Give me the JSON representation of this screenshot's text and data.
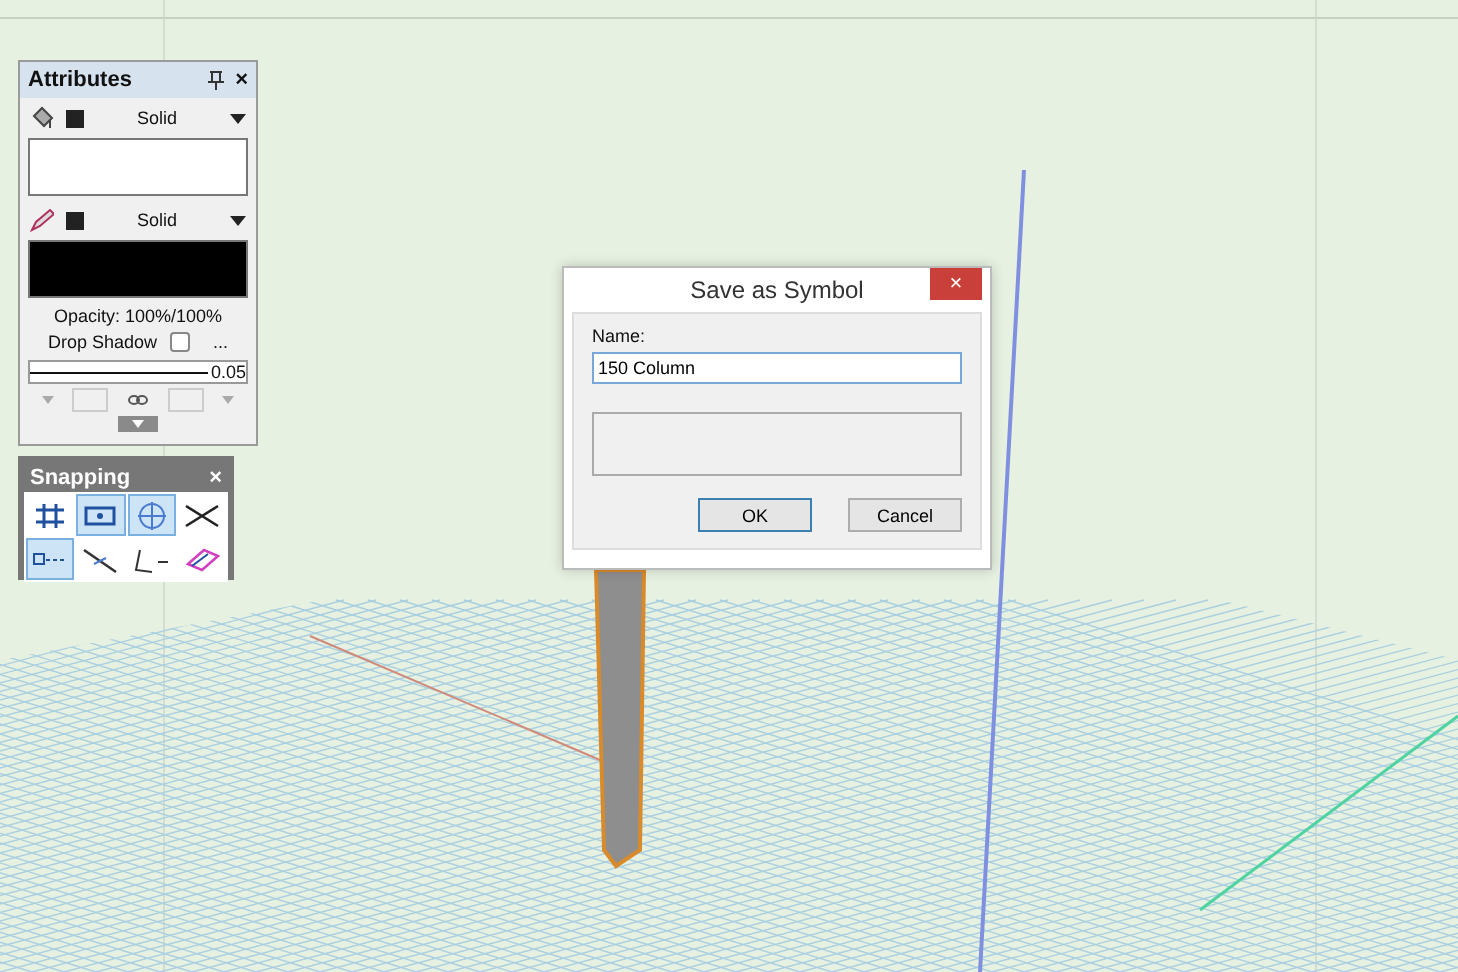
{
  "attributes": {
    "title": "Attributes",
    "close": "×",
    "fill": {
      "style": "Solid"
    },
    "pen": {
      "style": "Solid"
    },
    "opacity": "Opacity: 100%/100%",
    "drop_shadow": {
      "label": "Drop Shadow",
      "checked": false
    },
    "more": "...",
    "line_weight": "0.05"
  },
  "snapping": {
    "title": "Snapping",
    "close": "×",
    "buttons": [
      {
        "kind": "grid",
        "selected": false
      },
      {
        "kind": "box",
        "selected": true
      },
      {
        "kind": "target",
        "selected": true
      },
      {
        "kind": "cross",
        "selected": false
      },
      {
        "kind": "dash",
        "selected": true
      },
      {
        "kind": "slant",
        "selected": false
      },
      {
        "kind": "corner",
        "selected": false
      },
      {
        "kind": "tag",
        "selected": false
      }
    ]
  },
  "dialog": {
    "title": "Save as Symbol",
    "close": "×",
    "name_label": "Name:",
    "name_value": "150 Column",
    "buttons": [
      "OK",
      "Cancel"
    ]
  }
}
